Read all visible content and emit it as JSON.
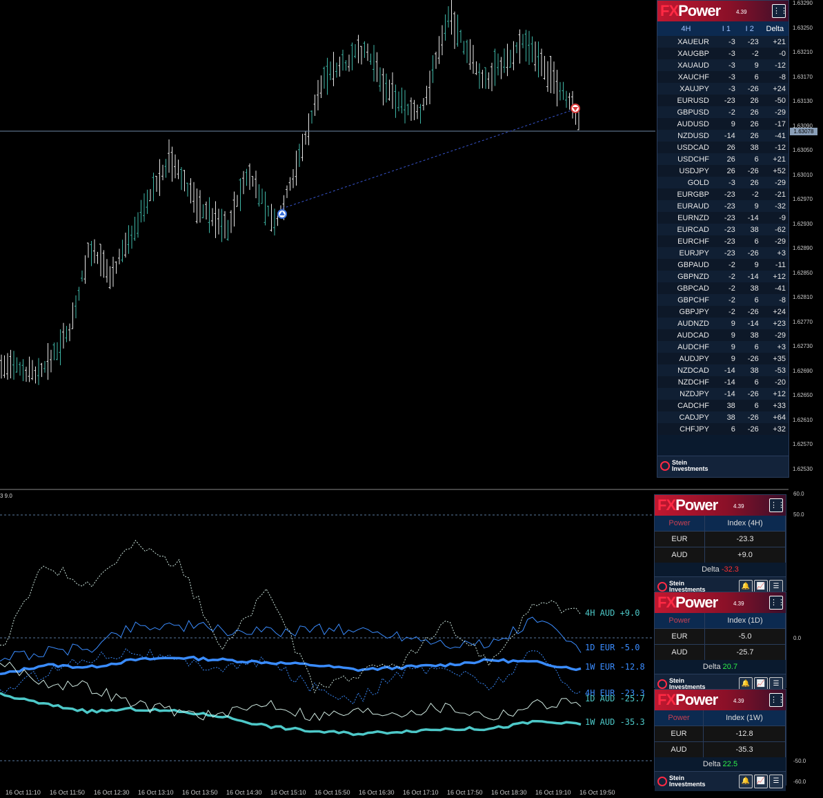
{
  "main": {
    "price_ticks": [
      "1.63290",
      "1.63250",
      "1.63210",
      "1.63170",
      "1.63130",
      "1.63090",
      "1.63050",
      "1.63010",
      "1.62970",
      "1.62930",
      "1.62890",
      "1.62850",
      "1.62810",
      "1.62770",
      "1.62730",
      "1.62690",
      "1.62650",
      "1.62610",
      "1.62570",
      "1.62530"
    ],
    "current_price": "1.63078"
  },
  "fxpower_table": {
    "logo_fx": "FX",
    "logo_power": "Power",
    "version": "4.39",
    "headers": [
      "4H",
      "I 1",
      "I 2",
      "Delta"
    ],
    "rows": [
      [
        "XAUEUR",
        "-3",
        "-23",
        "+21"
      ],
      [
        "XAUGBP",
        "-3",
        "-2",
        "-0"
      ],
      [
        "XAUAUD",
        "-3",
        "9",
        "-12"
      ],
      [
        "XAUCHF",
        "-3",
        "6",
        "-8"
      ],
      [
        "XAUJPY",
        "-3",
        "-26",
        "+24"
      ],
      [
        "EURUSD",
        "-23",
        "26",
        "-50"
      ],
      [
        "GBPUSD",
        "-2",
        "26",
        "-29"
      ],
      [
        "AUDUSD",
        "9",
        "26",
        "-17"
      ],
      [
        "NZDUSD",
        "-14",
        "26",
        "-41"
      ],
      [
        "USDCAD",
        "26",
        "38",
        "-12"
      ],
      [
        "USDCHF",
        "26",
        "6",
        "+21"
      ],
      [
        "USDJPY",
        "26",
        "-26",
        "+52"
      ],
      [
        "GOLD",
        "-3",
        "26",
        "-29"
      ],
      [
        "EURGBP",
        "-23",
        "-2",
        "-21"
      ],
      [
        "EURAUD",
        "-23",
        "9",
        "-32"
      ],
      [
        "EURNZD",
        "-23",
        "-14",
        "-9"
      ],
      [
        "EURCAD",
        "-23",
        "38",
        "-62"
      ],
      [
        "EURCHF",
        "-23",
        "6",
        "-29"
      ],
      [
        "EURJPY",
        "-23",
        "-26",
        "+3"
      ],
      [
        "GBPAUD",
        "-2",
        "9",
        "-11"
      ],
      [
        "GBPNZD",
        "-2",
        "-14",
        "+12"
      ],
      [
        "GBPCAD",
        "-2",
        "38",
        "-41"
      ],
      [
        "GBPCHF",
        "-2",
        "6",
        "-8"
      ],
      [
        "GBPJPY",
        "-2",
        "-26",
        "+24"
      ],
      [
        "AUDNZD",
        "9",
        "-14",
        "+23"
      ],
      [
        "AUDCAD",
        "9",
        "38",
        "-29"
      ],
      [
        "AUDCHF",
        "9",
        "6",
        "+3"
      ],
      [
        "AUDJPY",
        "9",
        "-26",
        "+35"
      ],
      [
        "NZDCAD",
        "-14",
        "38",
        "-53"
      ],
      [
        "NZDCHF",
        "-14",
        "6",
        "-20"
      ],
      [
        "NZDJPY",
        "-14",
        "-26",
        "+12"
      ],
      [
        "CADCHF",
        "38",
        "6",
        "+33"
      ],
      [
        "CADJPY",
        "38",
        "-26",
        "+64"
      ],
      [
        "CHFJPY",
        "6",
        "-26",
        "+32"
      ]
    ],
    "brand_line1": "Stein",
    "brand_line2": "Investments"
  },
  "indicator": {
    "label": "3 9.0",
    "level_ticks": [
      "60.0",
      "50.0",
      "0.0",
      "-50.0",
      "-60.0"
    ],
    "line_labels": [
      {
        "text": "4H AUD  +9.0",
        "color": "#4dc8c8"
      },
      {
        "text": "1D EUR  -5.0",
        "color": "#3a8cff"
      },
      {
        "text": "1W EUR -12.8",
        "color": "#3a8cff"
      },
      {
        "text": "4H EUR -23.3",
        "color": "#3a8cff"
      },
      {
        "text": "1D AUD -25.7",
        "color": "#4dc8c8"
      },
      {
        "text": "1W AUD -35.3",
        "color": "#4dc8c8"
      }
    ],
    "colors": {
      "eur": "#3a8cff",
      "aud": "#4dc8c8",
      "thin": "#cfe8e0"
    }
  },
  "mini_panels": [
    {
      "power_label": "Power",
      "index_label": "Index (4H)",
      "rows": [
        [
          "EUR",
          "-23.3"
        ],
        [
          "AUD",
          "+9.0"
        ]
      ],
      "delta_label": "Delta",
      "delta_value": "-32.3"
    },
    {
      "power_label": "Power",
      "index_label": "Index (1D)",
      "rows": [
        [
          "EUR",
          "-5.0"
        ],
        [
          "AUD",
          "-25.7"
        ]
      ],
      "delta_label": "Delta",
      "delta_value": "20.7"
    },
    {
      "power_label": "Power",
      "index_label": "Index (1W)",
      "rows": [
        [
          "EUR",
          "-12.8"
        ],
        [
          "AUD",
          "-35.3"
        ]
      ],
      "delta_label": "Delta",
      "delta_value": "22.5"
    }
  ],
  "time_axis": [
    "16 Oct 11:10",
    "16 Oct 11:50",
    "16 Oct 12:30",
    "16 Oct 13:10",
    "16 Oct 13:50",
    "16 Oct 14:30",
    "16 Oct 15:10",
    "16 Oct 15:50",
    "16 Oct 16:30",
    "16 Oct 17:10",
    "16 Oct 17:50",
    "16 Oct 18:30",
    "16 Oct 19:10",
    "16 Oct 19:50"
  ],
  "chart_data": {
    "type": "line",
    "title": "",
    "xlabel": "",
    "ylabel": "",
    "ylim": [
      -60,
      60
    ],
    "x": [
      "16 Oct 11:10",
      "16 Oct 11:50",
      "16 Oct 12:30",
      "16 Oct 13:10",
      "16 Oct 13:50",
      "16 Oct 14:30",
      "16 Oct 15:10",
      "16 Oct 15:50",
      "16 Oct 16:30",
      "16 Oct 17:10",
      "16 Oct 17:50",
      "16 Oct 18:30",
      "16 Oct 19:10",
      "16 Oct 19:50"
    ],
    "series": [
      {
        "name": "1W EUR",
        "values": [
          -15,
          -11,
          -12,
          -9,
          -8,
          -9,
          -10,
          -11,
          -13,
          -12,
          -11,
          -9,
          -10,
          -12.8
        ]
      },
      {
        "name": "1W AUD",
        "values": [
          -23,
          -27,
          -30,
          -29,
          -30,
          -32,
          -36,
          -38,
          -39,
          -38,
          -37,
          -37,
          -34,
          -35.3
        ]
      },
      {
        "name": "1D EUR",
        "values": [
          -8,
          -6,
          -4,
          5,
          5,
          3,
          2,
          4,
          3,
          1,
          -2,
          -3,
          8,
          -5.0
        ]
      },
      {
        "name": "1D AUD",
        "values": [
          -10,
          -18,
          -20,
          -27,
          -30,
          -32,
          -26,
          -32,
          -30,
          -30,
          -28,
          -32,
          -27,
          -25.7
        ]
      },
      {
        "name": "4H EUR",
        "values": [
          -22,
          -14,
          -8,
          -5,
          -10,
          -12,
          -10,
          -20,
          -25,
          -14,
          -12,
          -20,
          -5,
          -23.3
        ]
      },
      {
        "name": "4H AUD",
        "values": [
          -5,
          30,
          22,
          38,
          30,
          -5,
          20,
          -20,
          -15,
          -10,
          5,
          -10,
          15,
          9.0
        ]
      }
    ]
  }
}
